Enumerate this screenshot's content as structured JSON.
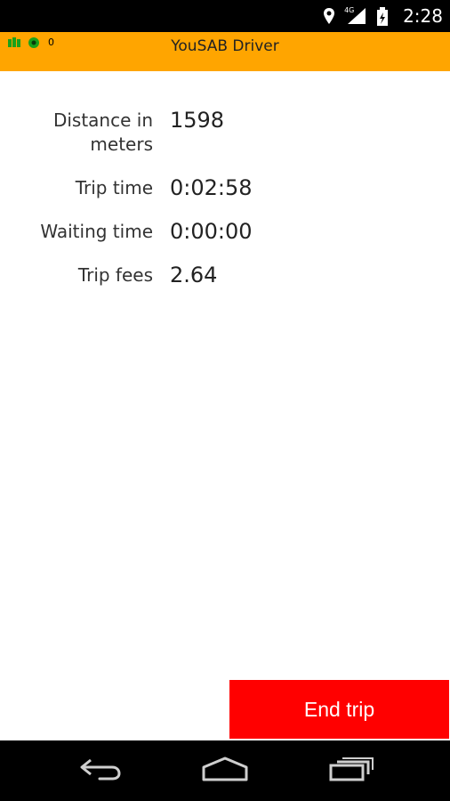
{
  "status_bar": {
    "time": "2:28",
    "network_label": "4G",
    "icons": [
      "location-icon",
      "signal-icon",
      "battery-icon"
    ]
  },
  "app_bar": {
    "title": "YouSAB Driver",
    "indicator_count": "0",
    "background_color": "#ffa500",
    "indicator_icons": [
      "gps-icon",
      "online-status-icon"
    ]
  },
  "trip": {
    "rows": [
      {
        "label": "Distance in meters",
        "value": "1598"
      },
      {
        "label": "Trip time",
        "value": "0:02:58"
      },
      {
        "label": "Waiting time",
        "value": "0:00:00"
      },
      {
        "label": "Trip fees",
        "value": "2.64"
      }
    ]
  },
  "actions": {
    "end_trip_label": "End trip",
    "end_trip_color": "#ff0000"
  },
  "nav_bar": {
    "icons": [
      "back-icon",
      "home-icon",
      "recent-apps-icon"
    ]
  }
}
